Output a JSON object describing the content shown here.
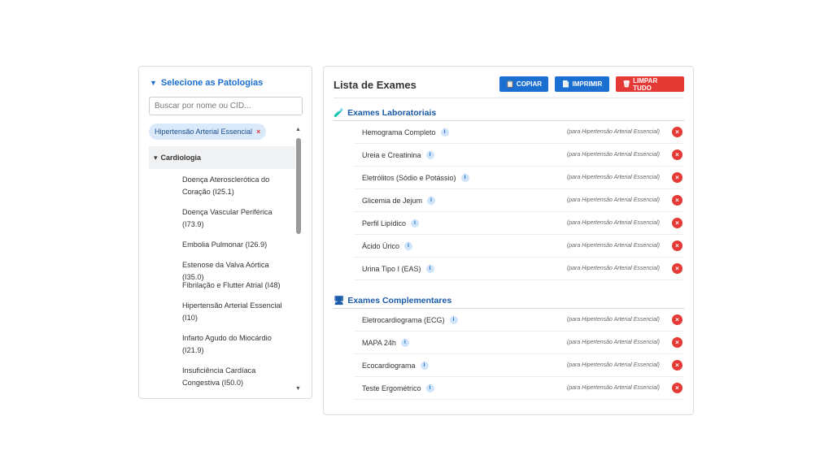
{
  "left": {
    "title": "Selecione as Patologias",
    "search_placeholder": "Buscar por nome ou CID...",
    "chip_label": "Hipertensão Arterial Essencial",
    "chip_remove": "×",
    "group": "Cardiologia",
    "items": [
      "Doença Aterosclerótica do Coração (I25.1)",
      "Doença Vascular Periférica (I73.9)",
      "Embolia Pulmonar (I26.9)",
      "Estenose da Valva Aórtica (I35.0)",
      "Fibrilação e Flutter Atrial (I48)",
      "Hipertensão Arterial Essencial (I10)",
      "Infarto Agudo do Miocárdio (I21.9)",
      "Insuficiência Cardíaca Congestiva (I50.0)"
    ]
  },
  "right": {
    "title": "Lista de Exames",
    "buttons": {
      "copy": "COPIAR",
      "print": "IMPRIMIR",
      "clear": "LIMPAR TUDO"
    },
    "for_label": "(para Hipertensão Arterial Essencial)",
    "lab_title": "Exames Laboratoriais",
    "lab": [
      "Hemograma Completo",
      "Ureia e Creatinina",
      "Eletrólitos (Sódio e Potássio)",
      "Glicemia de Jejum",
      "Perfil Lipídico",
      "Ácido Úrico",
      "Urina Tipo I (EAS)"
    ],
    "comp_title": "Exames Complementares",
    "comp": [
      "Eletrocardiograma (ECG)",
      "MAPA 24h",
      "Ecocardiograma",
      "Teste Ergométrico"
    ]
  },
  "icons": {
    "info": "i",
    "delete": "×",
    "lab": "flask-icon",
    "comp": "monitor-icon"
  },
  "colors": {
    "primary": "#1a6fd1",
    "danger": "#e53935",
    "chip": "#dbeafb"
  }
}
